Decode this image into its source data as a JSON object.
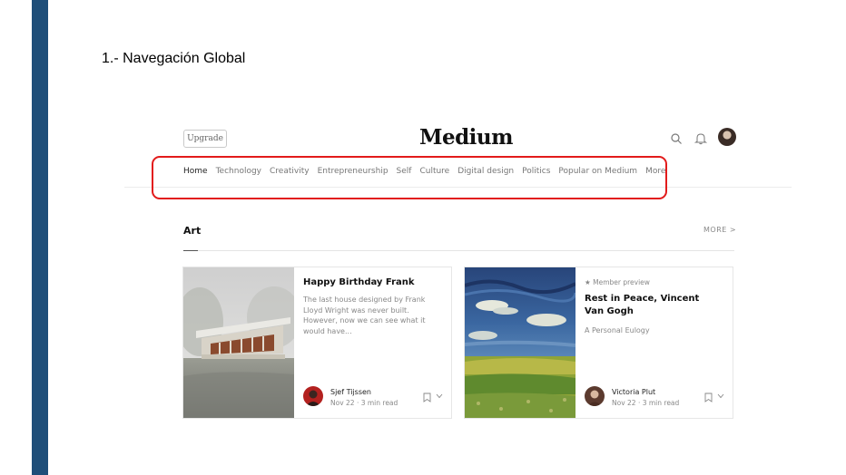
{
  "slide_title": "1.- Navegación Global",
  "header": {
    "upgrade_label": "Upgrade",
    "logo": "Medium"
  },
  "nav": {
    "items": [
      {
        "label": "Home",
        "active": true
      },
      {
        "label": "Technology"
      },
      {
        "label": "Creativity"
      },
      {
        "label": "Entrepreneurship"
      },
      {
        "label": "Self"
      },
      {
        "label": "Culture"
      },
      {
        "label": "Digital design"
      },
      {
        "label": "Politics"
      },
      {
        "label": "Popular on Medium"
      },
      {
        "label": "More"
      }
    ]
  },
  "section": {
    "title": "Art",
    "more_label": "MORE >"
  },
  "cards": [
    {
      "title": "Happy Birthday Frank",
      "description": "The last house designed by Frank Lloyd Wright was never built. However, now we can see what it would have...",
      "author": "Sjef Tijssen",
      "meta": "Nov 22 · 3 min read"
    },
    {
      "badge": "★ Member preview",
      "title": "Rest in Peace, Vincent Van Gogh",
      "description": "A Personal Eulogy",
      "author": "Victoria Plut",
      "meta": "Nov 22 · 3 min read"
    }
  ],
  "colors": {
    "slide_bar": "#1f4e79",
    "highlight": "#e21b1b"
  },
  "icons": [
    "search-icon",
    "bell-icon",
    "bookmark-icon",
    "chevron-down-icon"
  ]
}
